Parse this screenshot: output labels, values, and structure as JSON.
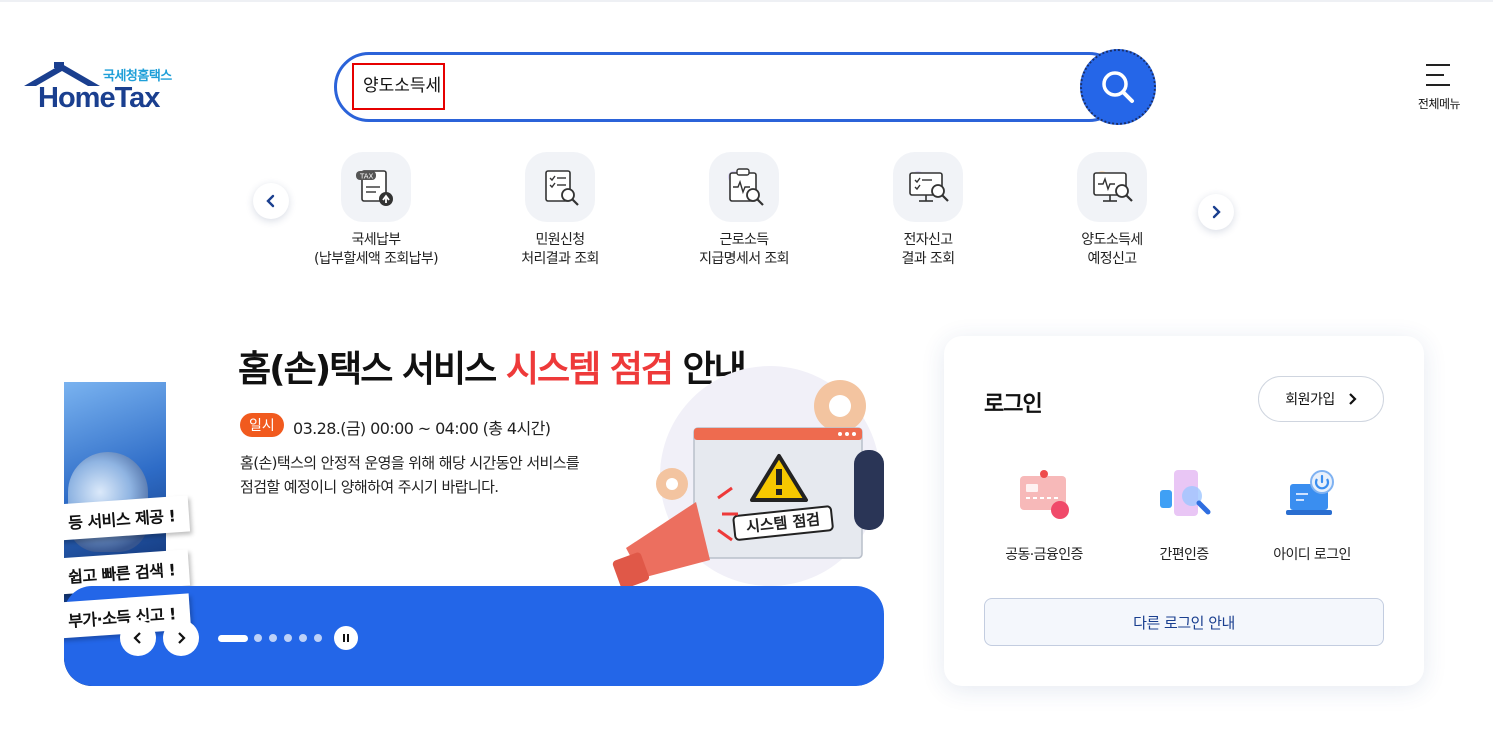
{
  "header": {
    "logo_sub": "국세청홈택스",
    "logo_main": "HomeTax",
    "search_value": "양도소득세",
    "full_menu_label": "전체메뉴"
  },
  "quick_menu": {
    "items": [
      {
        "line1": "국세납부",
        "line2": "(납부할세액 조회납부)",
        "icon": "tax-payment-icon"
      },
      {
        "line1": "민원신청",
        "line2": "처리결과 조회",
        "icon": "document-search-icon"
      },
      {
        "line1": "근로소득",
        "line2": "지급명세서 조회",
        "icon": "statement-search-icon"
      },
      {
        "line1": "전자신고",
        "line2": "결과 조회",
        "icon": "monitor-check-icon"
      },
      {
        "line1": "양도소득세",
        "line2": "예정신고",
        "icon": "monitor-search-icon"
      }
    ]
  },
  "banner": {
    "title_pre": "홈(손)택스 서비스 ",
    "title_red": "시스템 점검",
    "title_post": " 안내",
    "tag": "일시",
    "time": "03.28.(금) 00:00 ~ 04:00 (총 4시간)",
    "desc_line1": "홈(손)택스의 안정적 운영을 위해 해당 시간동안 서비스를",
    "desc_line2": "점검할 예정이니 양해하여 주시기 바랍니다.",
    "illus_label": "시스템 점검",
    "side_ribbons": [
      "등 서비스 제공 !",
      "쉽고 빠른 검색 !",
      "부가·소득 신고 !"
    ],
    "slide_count": 6,
    "active_slide": 1
  },
  "login": {
    "title": "로그인",
    "join_label": "회원가입",
    "options": [
      {
        "label": "공동·금융인증",
        "icon": "certificate-card-icon"
      },
      {
        "label": "간편인증",
        "icon": "simple-auth-icon"
      },
      {
        "label": "아이디 로그인",
        "icon": "id-login-laptop-icon"
      }
    ],
    "other_label": "다른 로그인 안내"
  },
  "colors": {
    "brand_blue": "#2566e8",
    "banner_red": "#ee3a3a",
    "tag_orange": "#f15a1e",
    "logo_navy": "#1a3f8f"
  }
}
